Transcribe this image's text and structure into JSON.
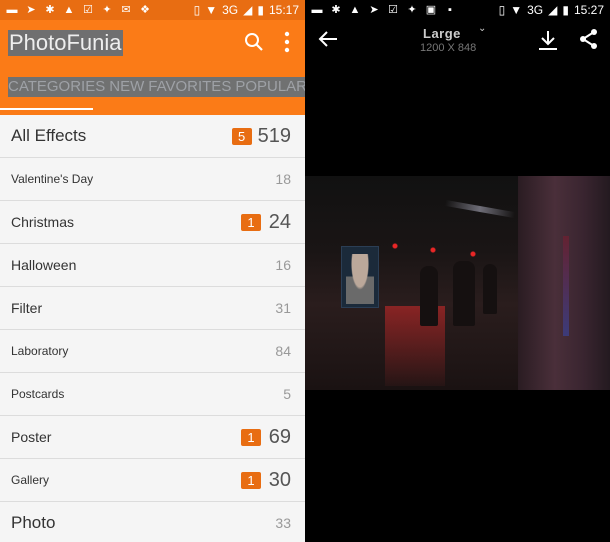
{
  "left": {
    "status_bar": {
      "icons": [
        "message-icon",
        "telegram-icon",
        "octopus-icon",
        "photo-icon",
        "checkbox-icon",
        "twitter-icon",
        "gmail-icon",
        "dropbox-icon"
      ],
      "right_icons": [
        "vibrate-icon",
        "wifi-icon",
        "signal-icon",
        "battery-icon"
      ],
      "network": "3G",
      "time": "15:17"
    },
    "app": {
      "title": "PhotoFunia",
      "accent": "#fb7b17",
      "badge_color": "#e86d12"
    },
    "tabs": [
      "CATEGORIES",
      "NEW",
      "FAVORITES",
      "POPULAR"
    ],
    "active_tab": "CATEGORIES",
    "categories": [
      {
        "label": "All Effects",
        "badge": "5",
        "count": "519"
      },
      {
        "label": "Valentine's Day",
        "badge": null,
        "count": "18"
      },
      {
        "label": "Christmas",
        "badge": "1",
        "count": "24"
      },
      {
        "label": "Halloween",
        "badge": null,
        "count": "16"
      },
      {
        "label": "Filter",
        "badge": null,
        "count": "31"
      },
      {
        "label": "Laboratory",
        "badge": null,
        "count": "84"
      },
      {
        "label": "Postcards",
        "badge": null,
        "count": "5"
      },
      {
        "label": "Poster",
        "badge": "1",
        "count": "69"
      },
      {
        "label": "Gallery",
        "badge": "1",
        "count": "30"
      },
      {
        "label": "Photo",
        "badge": null,
        "count": "33"
      }
    ]
  },
  "right": {
    "status_bar": {
      "icons": [
        "message-icon",
        "octopus-icon",
        "photo-icon",
        "telegram-icon",
        "checkbox-icon",
        "twitter-icon",
        "chat-icon",
        "image-icon"
      ],
      "right_icons": [
        "vibrate-icon",
        "wifi-icon",
        "signal-icon",
        "battery-icon"
      ],
      "network": "3G",
      "time": "15:27"
    },
    "viewer": {
      "size_label": "Large",
      "dimensions": "1200 X 848",
      "image_alt": "Night street scene with a portrait poster on a bus stop display"
    }
  }
}
